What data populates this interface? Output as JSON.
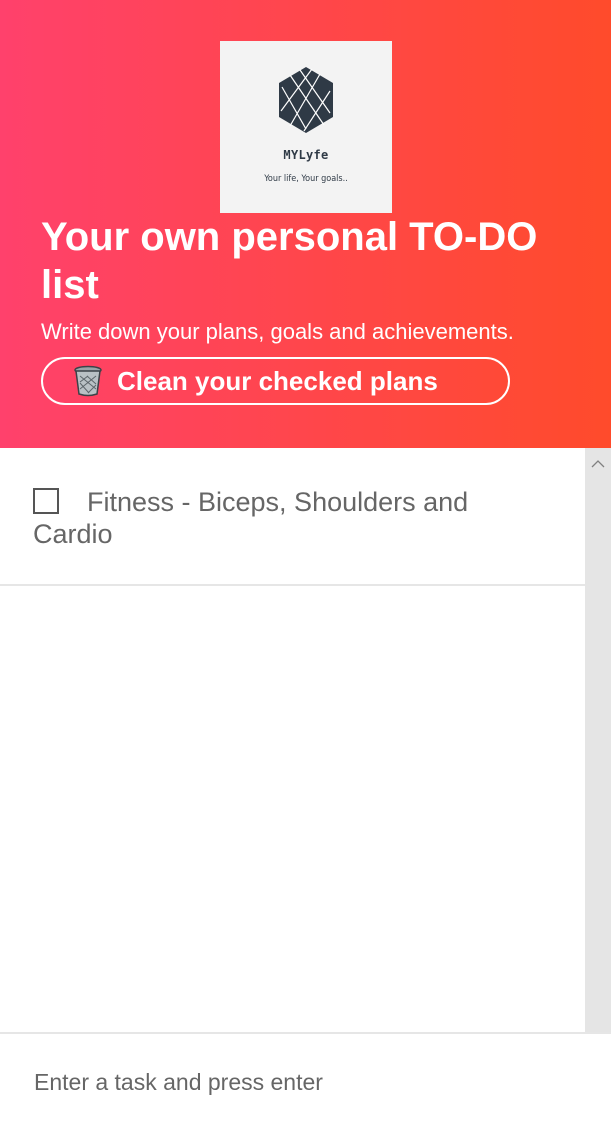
{
  "brand": {
    "name": "MYLyfe",
    "tagline": "Your life, Your goals.."
  },
  "hero": {
    "title": "Your own personal TO-DO list",
    "subtitle": "Write down your plans, goals and achievements.",
    "clean_button_label": "Clean your checked plans",
    "clean_button_icon": "trash-icon"
  },
  "tasks": [
    {
      "text": "Fitness - Biceps, Shoulders and Cardio",
      "checked": false
    }
  ],
  "input": {
    "placeholder": "Enter a task and press enter",
    "value": ""
  },
  "colors": {
    "gradient_start": "#ff416c",
    "gradient_end": "#ff4b2b",
    "logo_bg": "#f3f3f3",
    "logo_ink": "#2f3a46"
  }
}
